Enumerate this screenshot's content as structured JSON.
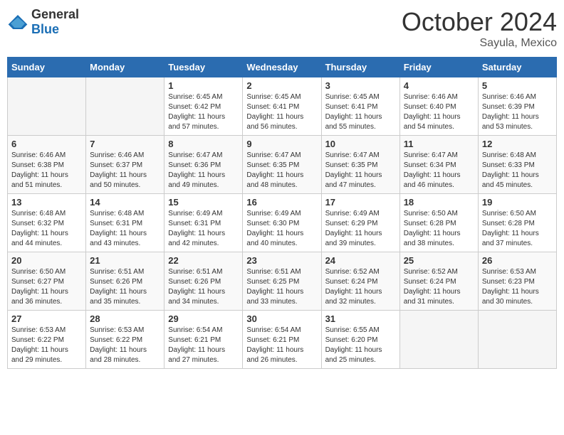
{
  "header": {
    "logo_general": "General",
    "logo_blue": "Blue",
    "month": "October 2024",
    "location": "Sayula, Mexico"
  },
  "days_of_week": [
    "Sunday",
    "Monday",
    "Tuesday",
    "Wednesday",
    "Thursday",
    "Friday",
    "Saturday"
  ],
  "weeks": [
    [
      {
        "day": "",
        "info": ""
      },
      {
        "day": "",
        "info": ""
      },
      {
        "day": "1",
        "info": "Sunrise: 6:45 AM\nSunset: 6:42 PM\nDaylight: 11 hours and 57 minutes."
      },
      {
        "day": "2",
        "info": "Sunrise: 6:45 AM\nSunset: 6:41 PM\nDaylight: 11 hours and 56 minutes."
      },
      {
        "day": "3",
        "info": "Sunrise: 6:45 AM\nSunset: 6:41 PM\nDaylight: 11 hours and 55 minutes."
      },
      {
        "day": "4",
        "info": "Sunrise: 6:46 AM\nSunset: 6:40 PM\nDaylight: 11 hours and 54 minutes."
      },
      {
        "day": "5",
        "info": "Sunrise: 6:46 AM\nSunset: 6:39 PM\nDaylight: 11 hours and 53 minutes."
      }
    ],
    [
      {
        "day": "6",
        "info": "Sunrise: 6:46 AM\nSunset: 6:38 PM\nDaylight: 11 hours and 51 minutes."
      },
      {
        "day": "7",
        "info": "Sunrise: 6:46 AM\nSunset: 6:37 PM\nDaylight: 11 hours and 50 minutes."
      },
      {
        "day": "8",
        "info": "Sunrise: 6:47 AM\nSunset: 6:36 PM\nDaylight: 11 hours and 49 minutes."
      },
      {
        "day": "9",
        "info": "Sunrise: 6:47 AM\nSunset: 6:35 PM\nDaylight: 11 hours and 48 minutes."
      },
      {
        "day": "10",
        "info": "Sunrise: 6:47 AM\nSunset: 6:35 PM\nDaylight: 11 hours and 47 minutes."
      },
      {
        "day": "11",
        "info": "Sunrise: 6:47 AM\nSunset: 6:34 PM\nDaylight: 11 hours and 46 minutes."
      },
      {
        "day": "12",
        "info": "Sunrise: 6:48 AM\nSunset: 6:33 PM\nDaylight: 11 hours and 45 minutes."
      }
    ],
    [
      {
        "day": "13",
        "info": "Sunrise: 6:48 AM\nSunset: 6:32 PM\nDaylight: 11 hours and 44 minutes."
      },
      {
        "day": "14",
        "info": "Sunrise: 6:48 AM\nSunset: 6:31 PM\nDaylight: 11 hours and 43 minutes."
      },
      {
        "day": "15",
        "info": "Sunrise: 6:49 AM\nSunset: 6:31 PM\nDaylight: 11 hours and 42 minutes."
      },
      {
        "day": "16",
        "info": "Sunrise: 6:49 AM\nSunset: 6:30 PM\nDaylight: 11 hours and 40 minutes."
      },
      {
        "day": "17",
        "info": "Sunrise: 6:49 AM\nSunset: 6:29 PM\nDaylight: 11 hours and 39 minutes."
      },
      {
        "day": "18",
        "info": "Sunrise: 6:50 AM\nSunset: 6:28 PM\nDaylight: 11 hours and 38 minutes."
      },
      {
        "day": "19",
        "info": "Sunrise: 6:50 AM\nSunset: 6:28 PM\nDaylight: 11 hours and 37 minutes."
      }
    ],
    [
      {
        "day": "20",
        "info": "Sunrise: 6:50 AM\nSunset: 6:27 PM\nDaylight: 11 hours and 36 minutes."
      },
      {
        "day": "21",
        "info": "Sunrise: 6:51 AM\nSunset: 6:26 PM\nDaylight: 11 hours and 35 minutes."
      },
      {
        "day": "22",
        "info": "Sunrise: 6:51 AM\nSunset: 6:26 PM\nDaylight: 11 hours and 34 minutes."
      },
      {
        "day": "23",
        "info": "Sunrise: 6:51 AM\nSunset: 6:25 PM\nDaylight: 11 hours and 33 minutes."
      },
      {
        "day": "24",
        "info": "Sunrise: 6:52 AM\nSunset: 6:24 PM\nDaylight: 11 hours and 32 minutes."
      },
      {
        "day": "25",
        "info": "Sunrise: 6:52 AM\nSunset: 6:24 PM\nDaylight: 11 hours and 31 minutes."
      },
      {
        "day": "26",
        "info": "Sunrise: 6:53 AM\nSunset: 6:23 PM\nDaylight: 11 hours and 30 minutes."
      }
    ],
    [
      {
        "day": "27",
        "info": "Sunrise: 6:53 AM\nSunset: 6:22 PM\nDaylight: 11 hours and 29 minutes."
      },
      {
        "day": "28",
        "info": "Sunrise: 6:53 AM\nSunset: 6:22 PM\nDaylight: 11 hours and 28 minutes."
      },
      {
        "day": "29",
        "info": "Sunrise: 6:54 AM\nSunset: 6:21 PM\nDaylight: 11 hours and 27 minutes."
      },
      {
        "day": "30",
        "info": "Sunrise: 6:54 AM\nSunset: 6:21 PM\nDaylight: 11 hours and 26 minutes."
      },
      {
        "day": "31",
        "info": "Sunrise: 6:55 AM\nSunset: 6:20 PM\nDaylight: 11 hours and 25 minutes."
      },
      {
        "day": "",
        "info": ""
      },
      {
        "day": "",
        "info": ""
      }
    ]
  ]
}
